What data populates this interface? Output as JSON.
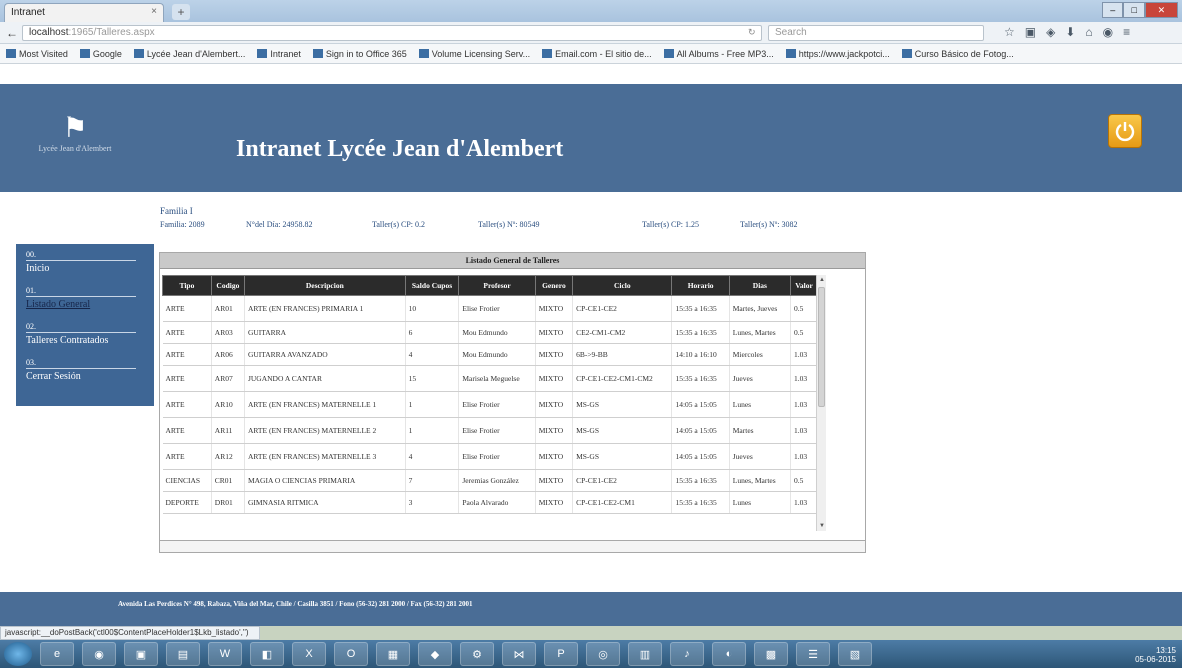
{
  "browser": {
    "tab_title": "Intranet",
    "tab_close": "×",
    "new_tab": "+",
    "url_main": "localhost",
    "url_rest": ":1965/Talleres.aspx",
    "search_placeholder": "Search",
    "window_buttons": [
      "–",
      "□",
      "✕"
    ],
    "bookmarks": [
      "Most Visited",
      "Google",
      "Lycée Jean d'Alembert...",
      "Intranet",
      "Sign in to Office 365",
      "Volume Licensing Serv...",
      "Email.com - El sitio de...",
      "All Albums - Free MP3...",
      "https://www.jackpotci...",
      "Curso Básico de Fotog..."
    ]
  },
  "header": {
    "site_title": "Intranet Lycée Jean d'Alembert",
    "logo_text": "Lycée Jean d'Alembert"
  },
  "info": {
    "family": "Familia I",
    "items": [
      "Familia: 2089",
      "N°del Día: 24958.82",
      "Taller(s) CP: 0.2",
      "Taller(s) Nº: 80549",
      "Taller(s) CP: 1.25",
      "Taller(s) Nº: 3082"
    ]
  },
  "sidebar": {
    "items": [
      {
        "num": "00.",
        "label": "Inicio",
        "active": false
      },
      {
        "num": "01.",
        "label": "Listado General",
        "active": true
      },
      {
        "num": "02.",
        "label": "Talleres Contratados",
        "active": false
      },
      {
        "num": "03.",
        "label": "Cerrar Sesión",
        "active": false
      }
    ]
  },
  "table": {
    "title": "Listado General de Talleres",
    "headers": [
      "Tipo",
      "Codigo",
      "Descripcion",
      "Saldo Cupos",
      "Profesor",
      "Genero",
      "Ciclo",
      "Horario",
      "Dias",
      "Valor"
    ],
    "rows": [
      [
        "ARTE",
        "AR01",
        "ARTE (EN FRANCES) PRIMARIA 1",
        "10",
        "Elise Frotier",
        "MIXTO",
        "CP-CE1-CE2",
        "15:35 a 16:35",
        "Martes, Jueves",
        "0.5"
      ],
      [
        "ARTE",
        "AR03",
        "GUITARRA",
        "6",
        "Mou Edmundo",
        "MIXTO",
        "CE2-CM1-CM2",
        "15:35 a 16:35",
        "Lunes, Martes",
        "0.5"
      ],
      [
        "ARTE",
        "AR06",
        "GUITARRA AVANZADO",
        "4",
        "Mou Edmundo",
        "MIXTO",
        "6B->9-BB",
        "14:10 a 16:10",
        "Miercoles",
        "1.03"
      ],
      [
        "ARTE",
        "AR07",
        "JUGANDO A CANTAR",
        "15",
        "Marisela Meguelse",
        "MIXTO",
        "CP-CE1-CE2-CM1-CM2",
        "15:35 a 16:35",
        "Jueves",
        "1.03"
      ],
      [
        "ARTE",
        "AR10",
        "ARTE (EN FRANCES) MATERNELLE 1",
        "1",
        "Elise Frotier",
        "MIXTO",
        "MS-GS",
        "14:05 a 15:05",
        "Lunes",
        "1.03"
      ],
      [
        "ARTE",
        "AR11",
        "ARTE (EN FRANCES) MATERNELLE 2",
        "1",
        "Elise Frotier",
        "MIXTO",
        "MS-GS",
        "14:05 a 15:05",
        "Martes",
        "1.03"
      ],
      [
        "ARTE",
        "AR12",
        "ARTE (EN FRANCES) MATERNELLE 3",
        "4",
        "Elise Frotier",
        "MIXTO",
        "MS-GS",
        "14:05 a 15:05",
        "Jueves",
        "1.03"
      ],
      [
        "CIENCIAS",
        "CR01",
        "MAGIA O CIENCIAS PRIMARIA",
        "7",
        "Jeremias González",
        "MIXTO",
        "CP-CE1-CE2",
        "15:35 a 16:35",
        "Lunes, Martes",
        "0.5"
      ],
      [
        "DEPORTE",
        "DR01",
        "GIMNASIA RITMICA",
        "3",
        "Paola Alvarado",
        "MIXTO",
        "CP-CE1-CE2-CM1",
        "15:35 a 16:35",
        "Lunes",
        "1.03"
      ]
    ]
  },
  "footer": {
    "text": "Avenida Las Perdices N° 498, Rabaza, Viña del Mar, Chile / Casilla 3851 / Fono (56-32) 281 2000 / Fax (56-32) 281 2001"
  },
  "status": {
    "text": "javascript:__doPostBack('ctl00$ContentPlaceHolder1$Lkb_listado','')"
  },
  "taskbar": {
    "apps": [
      "e",
      "◉",
      "▣",
      "▤",
      "W",
      "◧",
      "X",
      "O",
      "▦",
      "◆",
      "⚙",
      "⋈",
      "P",
      "◎",
      "▥",
      "♪",
      "◐",
      "▩",
      "☰",
      "▧"
    ],
    "time": "13:15",
    "date": "05-06-2015"
  }
}
